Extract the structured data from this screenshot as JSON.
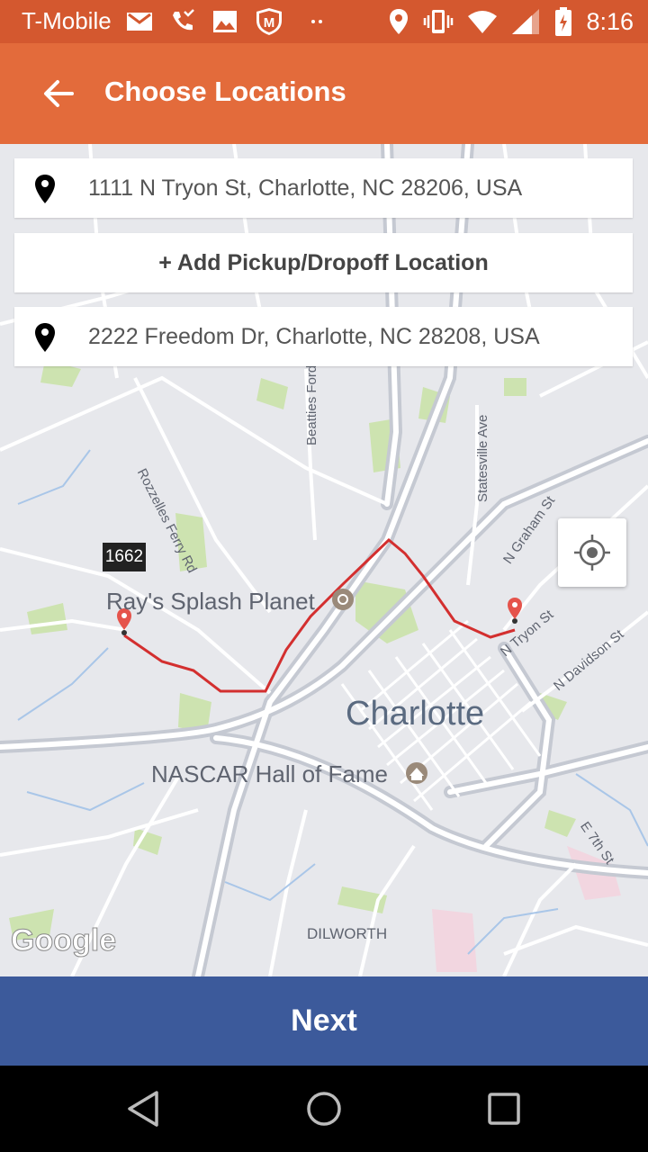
{
  "status_bar": {
    "carrier": "T-Mobile",
    "time": "8:16",
    "icons": [
      "gmail-icon",
      "missed-call-icon",
      "gallery-icon",
      "mcafee-icon",
      "dots-icon",
      "location-icon",
      "vibrate-icon",
      "wifi-icon",
      "signal-icon",
      "battery-icon"
    ]
  },
  "app_bar": {
    "title": "Choose Locations",
    "back_icon": "arrow-left-icon"
  },
  "colors": {
    "status_bar": "#d4582f",
    "app_bar": "#e36b3b",
    "next_button": "#3c5a9b",
    "route": "#d32f2f",
    "map_background": "#e7e8ec"
  },
  "form": {
    "pickup_address": "1111 N Tryon St, Charlotte, NC 28206, USA",
    "add_stop_label": "+ Add Pickup/Dropoff Location",
    "dropoff_address": "2222 Freedom Dr, Charlotte, NC 28208, USA"
  },
  "map": {
    "labels": {
      "city": "Charlotte",
      "poi_splash": "Ray's Splash Planet",
      "poi_nascar": "NASCAR Hall of Fame",
      "district": "DILWORTH",
      "road_shield": "1662",
      "street_rozzelles": "Rozzelles Ferry Rd",
      "street_beatties": "Beatties Ford Rd",
      "street_statesville": "Statesville Ave",
      "street_graham": "N Graham St",
      "street_tryon": "N Tryon St",
      "street_davidson": "N Davidson St",
      "street_e7th": "E 7th St",
      "attribution": "Google"
    },
    "my_location_icon": "crosshair-icon"
  },
  "actions": {
    "next_label": "Next"
  },
  "nav_bar": {
    "icons": [
      "back-triangle-icon",
      "home-circle-icon",
      "recents-square-icon"
    ]
  }
}
